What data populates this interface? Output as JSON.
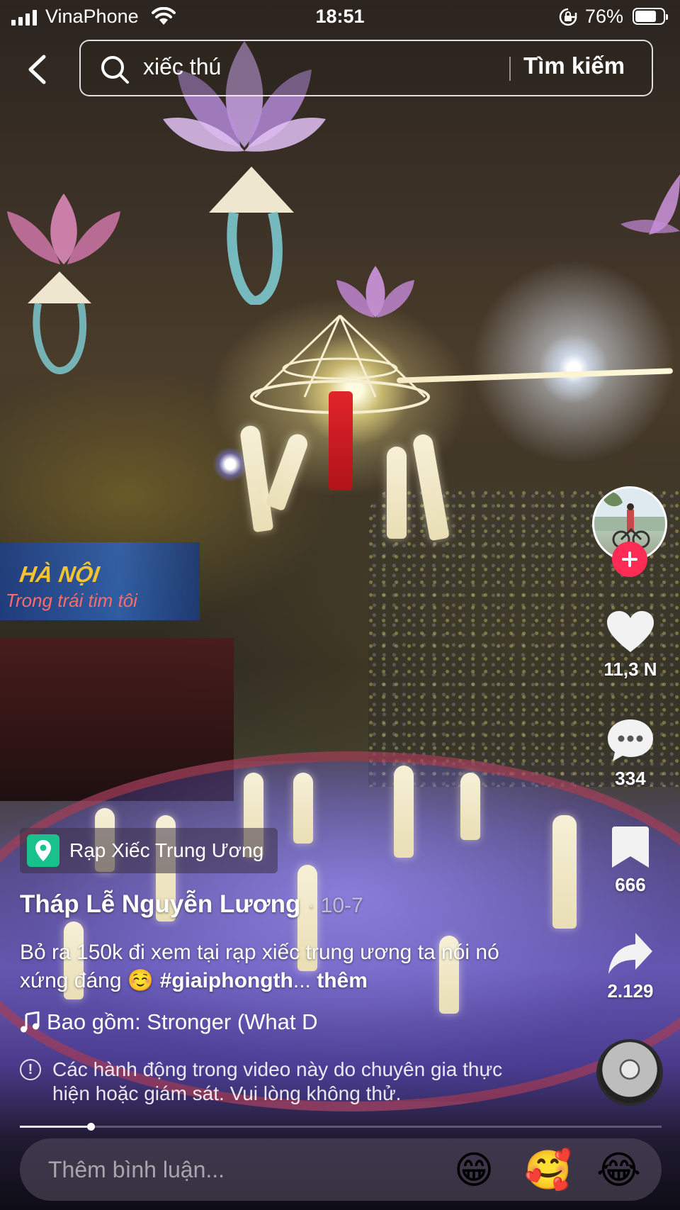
{
  "status_bar": {
    "carrier": "VinaPhone",
    "time": "18:51",
    "battery_percent": "76%",
    "battery_level": 0.76
  },
  "search": {
    "query": "xiếc thú",
    "button_label": "Tìm kiếm"
  },
  "video_scene": {
    "banner_title": "HÀ NỘI",
    "banner_subtitle": "Trong trái tim tôi"
  },
  "actions": {
    "likes": "11,3 N",
    "comments": "334",
    "saves": "666",
    "shares": "2.129"
  },
  "post": {
    "location": "Rạp Xiếc Trung Ương",
    "author": "Tháp Lễ Nguyễn Lương",
    "date": "· 10-7",
    "caption_text": "Bỏ ra 150k đi xem tại rạp xiếc trung ương ta nói nó xứng đáng ☺️ ",
    "hashtag": "#giaiphongth",
    "ellipsis": "... ",
    "more_label": "thêm",
    "music": "Bao gồm: Stronger (What D",
    "warning": "Các hành động trong video này do chuyên gia thực hiện hoặc giám sát. Vui lòng không thử.",
    "progress": 0.11
  },
  "comment_bar": {
    "placeholder": "Thêm bình luận...",
    "emojis": [
      "😁",
      "🥰",
      "😂"
    ]
  },
  "colors": {
    "follow": "#fe2c55",
    "location_pin": "#19c28a"
  }
}
